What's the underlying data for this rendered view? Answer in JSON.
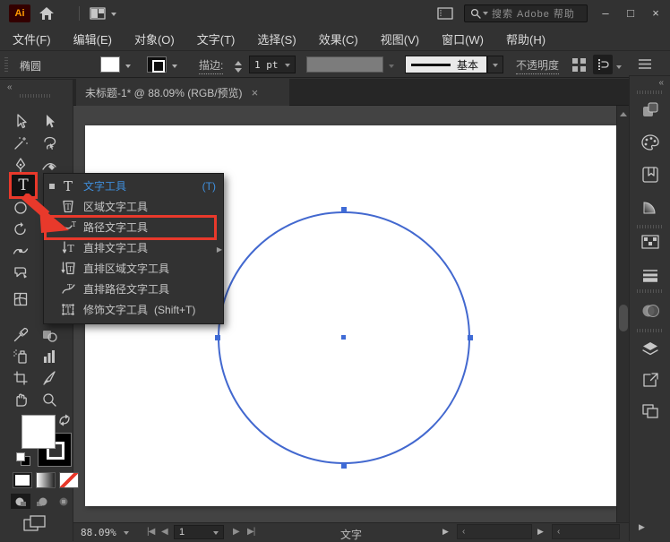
{
  "titlebar": {
    "logo_text": "Ai",
    "search_placeholder": "搜索 Adobe 帮助",
    "minimize": "–",
    "maximize": "□",
    "close": "×"
  },
  "menubar": {
    "items": [
      "文件(F)",
      "编辑(E)",
      "对象(O)",
      "文字(T)",
      "选择(S)",
      "效果(C)",
      "视图(V)",
      "窗口(W)",
      "帮助(H)"
    ]
  },
  "controlbar": {
    "selection_label": "椭圆",
    "stroke_label": "描边:",
    "stroke_value": "1 pt",
    "style_value": "基本",
    "opacity_label": "不透明度"
  },
  "tab": {
    "title": "未标题-1* @ 88.09% (RGB/预览)",
    "close": "×"
  },
  "type_menu": {
    "items": [
      {
        "label": "文字工具",
        "shortcut": "(T)",
        "state": "current"
      },
      {
        "label": "区域文字工具",
        "shortcut": ""
      },
      {
        "label": "路径文字工具",
        "shortcut": "",
        "state": "red-highlight"
      },
      {
        "label": "直排文字工具",
        "shortcut": ""
      },
      {
        "label": "直排区域文字工具",
        "shortcut": ""
      },
      {
        "label": "直排路径文字工具",
        "shortcut": ""
      },
      {
        "label": "修饰文字工具",
        "shortcut": "(Shift+T)"
      }
    ]
  },
  "toolbar": {
    "selected_tool": "type-tool",
    "tools": [
      "selection-tool",
      "direct-selection-tool",
      "magic-wand-tool",
      "lasso-tool",
      "pen-tool",
      "curvature-tool",
      "type-tool",
      "ellipse-tool",
      "rotate-tool",
      "width-tool",
      "shaper-tool",
      "mesh-tool",
      "eyedropper-tool",
      "blend-tool",
      "symbol-sprayer-tool",
      "graph-tool",
      "artboard-tool",
      "slice-tool",
      "hand-tool",
      "zoom-tool"
    ]
  },
  "dock": {
    "icons": [
      "collapse-icon",
      "properties-icon",
      "color-icon",
      "swatches-icon",
      "gradient-icon",
      "pattern-icon",
      "stroke-icon",
      "transparency-icon",
      "layers-icon",
      "export-icon",
      "artboards-icon",
      "expand-icon"
    ]
  },
  "statusbar": {
    "zoom": "88.09%",
    "artboard_number": "1",
    "tool_status": "文字"
  },
  "canvas": {
    "shape": "circle-with-selection-anchors"
  },
  "colors": {
    "panel": "#333333",
    "pasteboard": "#434343",
    "artboard": "#ffffff",
    "selection_blue": "#4268cf",
    "menu_accent_blue": "#3f8fdd",
    "annotation_red": "#e8392b",
    "logo_bg": "#330000",
    "logo_fg": "#ff9a00"
  }
}
